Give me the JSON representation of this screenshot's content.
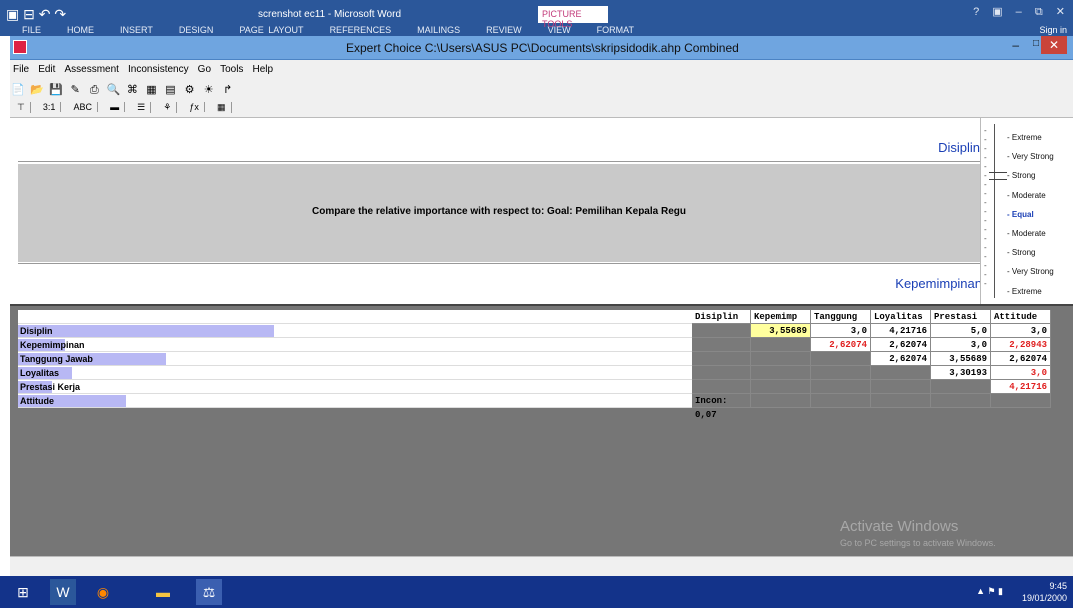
{
  "word": {
    "title": "screnshot ec11 - Microsoft Word",
    "picture_tools": "PICTURE TOOLS",
    "ribbon_tabs": [
      "FILE",
      "HOME",
      "INSERT",
      "DESIGN",
      "PAGE LAYOUT",
      "REFERENCES",
      "MAILINGS",
      "REVIEW",
      "VIEW",
      "FORMAT"
    ],
    "sign_in": "Sign in",
    "window_controls": "?  ▣  –  ⧉  ✕"
  },
  "ec_window": {
    "title": "Expert Choice    C:\\Users\\ASUS PC\\Documents\\skripsidodik.ahp   Combined",
    "min": "–",
    "max": "□",
    "close": "✕"
  },
  "menu": [
    "File",
    "Edit",
    "Assessment",
    "Inconsistency",
    "Go",
    "Tools",
    "Help"
  ],
  "toolbar_icons": [
    "new-icon",
    "open-icon",
    "save-icon",
    "edit-icon",
    "print-icon",
    "preview-icon",
    "tree-icon",
    "calc-icon",
    "graph-icon",
    "settings-icon",
    "lightbulb-icon",
    "arrow-icon"
  ],
  "toolbar2": [
    "⊤",
    "3:1",
    "ABC",
    "▬",
    "☰",
    "⚘",
    "ƒx",
    "▦"
  ],
  "comparison": {
    "top_element": "Disiplin",
    "question": "Compare the relative importance with respect to: Goal: Pemilihan Kepala Regu",
    "bottom_element": "Kepemimpinan"
  },
  "scale": {
    "items": [
      "Extreme",
      "Very Strong",
      "Strong",
      "Moderate",
      "Equal",
      "Moderate",
      "Strong",
      "Very Strong",
      "Extreme"
    ],
    "selected_index": 4
  },
  "matrix": {
    "columns": [
      "Disiplin",
      "Kepemimp",
      "Tanggung .",
      "Loyalitas",
      "Prestasi K",
      "Attitude"
    ],
    "rows": [
      {
        "label": "Disiplin",
        "bar": 0.38,
        "cells": [
          null,
          "3,55689",
          "3,0",
          "4,21716",
          "5,0",
          "3,0"
        ],
        "red": [
          false,
          false,
          false,
          false,
          false,
          false
        ]
      },
      {
        "label": "Kepemimpinan",
        "bar": 0.07,
        "cells": [
          null,
          null,
          "2,62074",
          "2,62074",
          "3,0",
          "2,28943"
        ],
        "red": [
          false,
          false,
          true,
          false,
          false,
          true
        ]
      },
      {
        "label": "Tanggung Jawab",
        "bar": 0.22,
        "cells": [
          null,
          null,
          null,
          "2,62074",
          "3,55689",
          "2,62074"
        ],
        "red": [
          false,
          false,
          false,
          false,
          false,
          false
        ]
      },
      {
        "label": "Loyalitas",
        "bar": 0.08,
        "cells": [
          null,
          null,
          null,
          null,
          "3,30193",
          "3,0"
        ],
        "red": [
          false,
          false,
          false,
          false,
          false,
          true
        ]
      },
      {
        "label": "Prestasi Kerja",
        "bar": 0.05,
        "cells": [
          null,
          null,
          null,
          null,
          null,
          "4,21716"
        ],
        "red": [
          false,
          false,
          false,
          false,
          false,
          true
        ]
      },
      {
        "label": "Attitude",
        "bar": 0.16,
        "cells": [
          null,
          null,
          null,
          null,
          null,
          null
        ],
        "red": [
          false,
          false,
          false,
          false,
          false,
          false
        ]
      }
    ],
    "inconsistency": "Incon: 0,07",
    "highlight_cell": "3,55689"
  },
  "watermark": {
    "line1": "Activate Windows",
    "line2": "Go to PC settings to activate Windows."
  },
  "taskbar": {
    "time": "9:45",
    "date": "19/01/2000"
  }
}
